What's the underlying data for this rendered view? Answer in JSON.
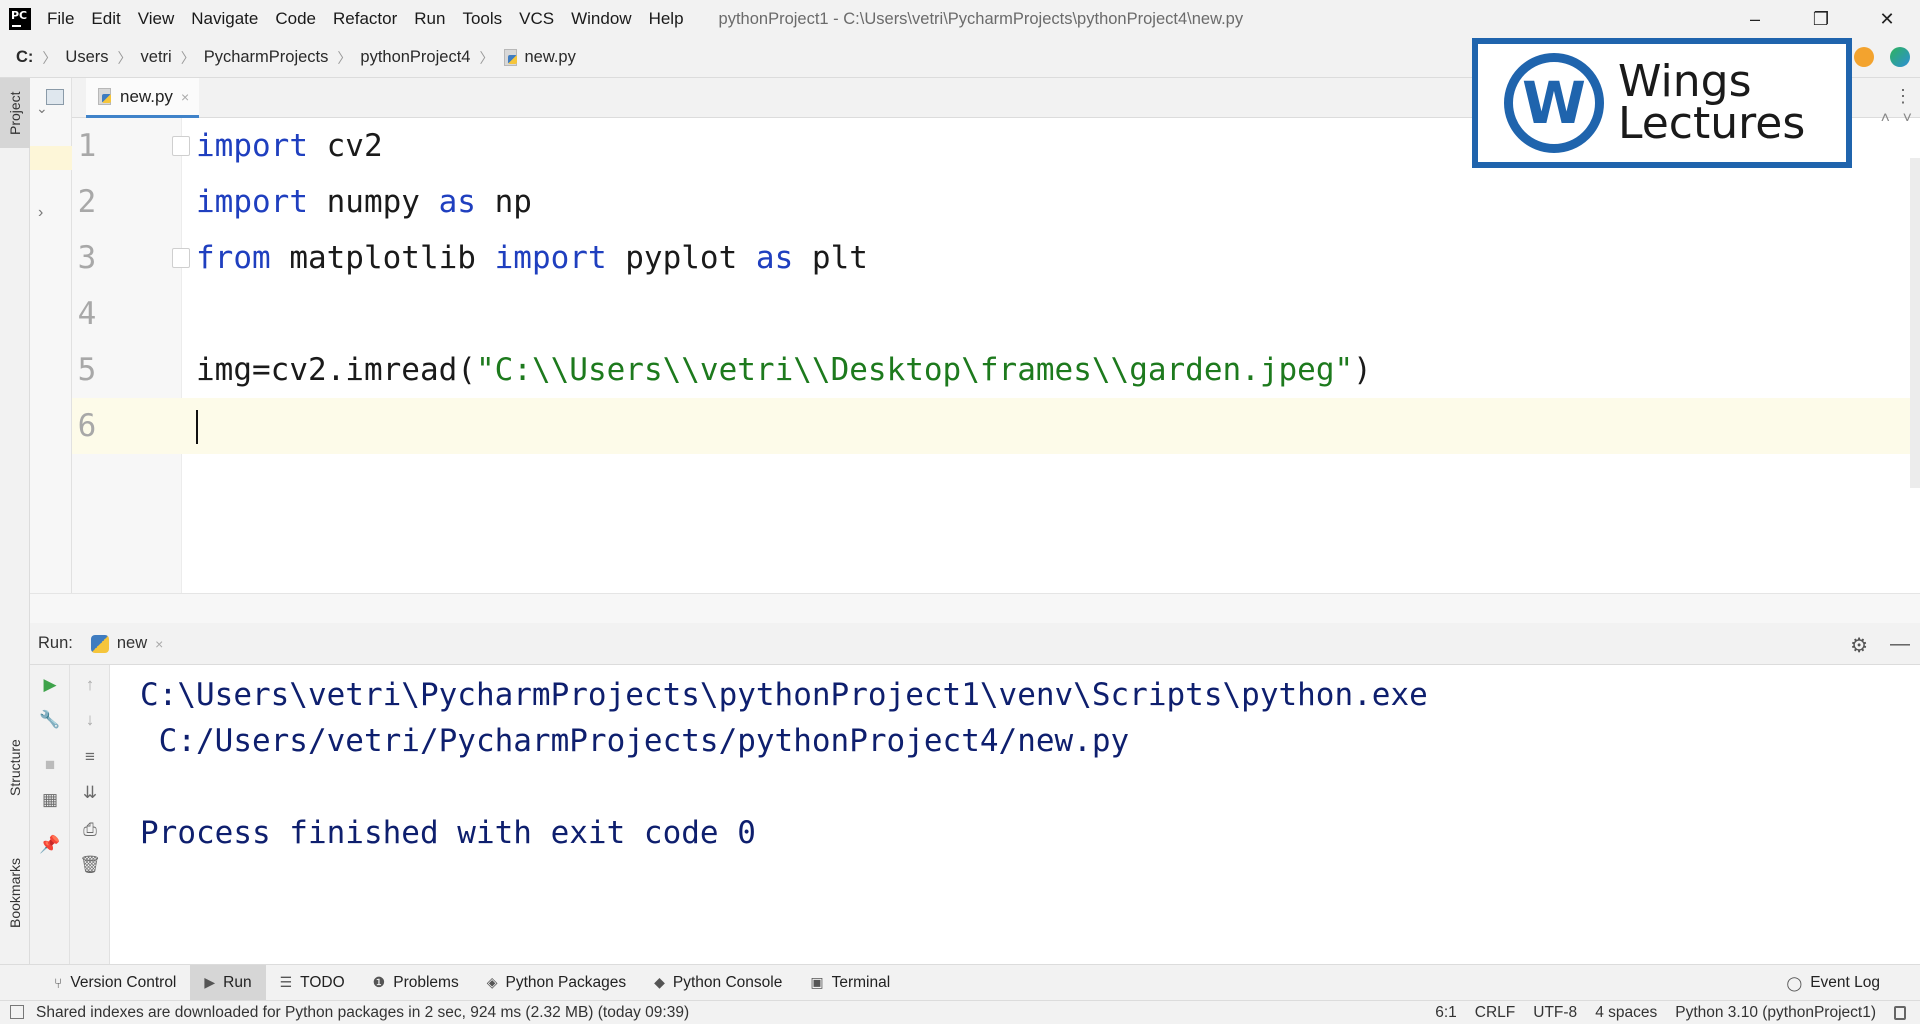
{
  "menubar": {
    "items": [
      "File",
      "Edit",
      "View",
      "Navigate",
      "Code",
      "Refactor",
      "Run",
      "Tools",
      "VCS",
      "Window",
      "Help"
    ],
    "window_title": "pythonProject1 - C:\\Users\\vetri\\PycharmProjects\\pythonProject4\\new.py",
    "minimize": "–",
    "restore": "❐",
    "close": "✕"
  },
  "breadcrumb": {
    "items": [
      "C:",
      "Users",
      "vetri",
      "PycharmProjects",
      "pythonProject4"
    ],
    "file": "new.py",
    "sep": "〉"
  },
  "left_strip": {
    "project_tab": "Project",
    "structure_tab": "Structure",
    "bookmarks_tab": "Bookmarks"
  },
  "editor": {
    "tab_label": "new.py",
    "tab_close": "×",
    "lines": [
      {
        "no": "1",
        "code": "import cv2"
      },
      {
        "no": "2",
        "code": "import numpy as np"
      },
      {
        "no": "3",
        "code": "from matplotlib import pyplot as plt"
      },
      {
        "no": "4",
        "code": ""
      },
      {
        "no": "5",
        "code": "img=cv2.imread(\"C:\\\\Users\\\\vetri\\\\Desktop\\frames\\\\garden.jpeg\")"
      },
      {
        "no": "6",
        "code": ""
      }
    ]
  },
  "watermark": {
    "letter": "W",
    "line1": "Wings",
    "line2": "Lectures"
  },
  "run": {
    "label": "Run:",
    "tab_label": "new",
    "tab_close": "×",
    "console": [
      "C:\\Users\\vetri\\PycharmProjects\\pythonProject1\\venv\\Scripts\\python.exe",
      " C:/Users/vetri/PycharmProjects/pythonProject4/new.py",
      "",
      "Process finished with exit code 0"
    ]
  },
  "tool_windows": {
    "items": [
      {
        "label": "Version Control",
        "icon": "branch-icon"
      },
      {
        "label": "Run",
        "icon": "play-icon"
      },
      {
        "label": "TODO",
        "icon": "list-icon"
      },
      {
        "label": "Problems",
        "icon": "info-icon"
      },
      {
        "label": "Python Packages",
        "icon": "packages-icon"
      },
      {
        "label": "Python Console",
        "icon": "python-icon"
      },
      {
        "label": "Terminal",
        "icon": "terminal-icon"
      }
    ],
    "event_log": "Event Log"
  },
  "statusbar": {
    "message": "Shared indexes are downloaded for Python packages in 2 sec, 924 ms (2.32 MB) (today 09:39)",
    "position": "6:1",
    "line_sep": "CRLF",
    "encoding": "UTF-8",
    "indent": "4 spaces",
    "interpreter": "Python 3.10 (pythonProject1)"
  },
  "colors": {
    "keyword": "#1f3fbf",
    "string": "#1d7a1d",
    "console_text": "#0e1f6e",
    "accent": "#4083c9",
    "watermark": "#1f64ad"
  }
}
